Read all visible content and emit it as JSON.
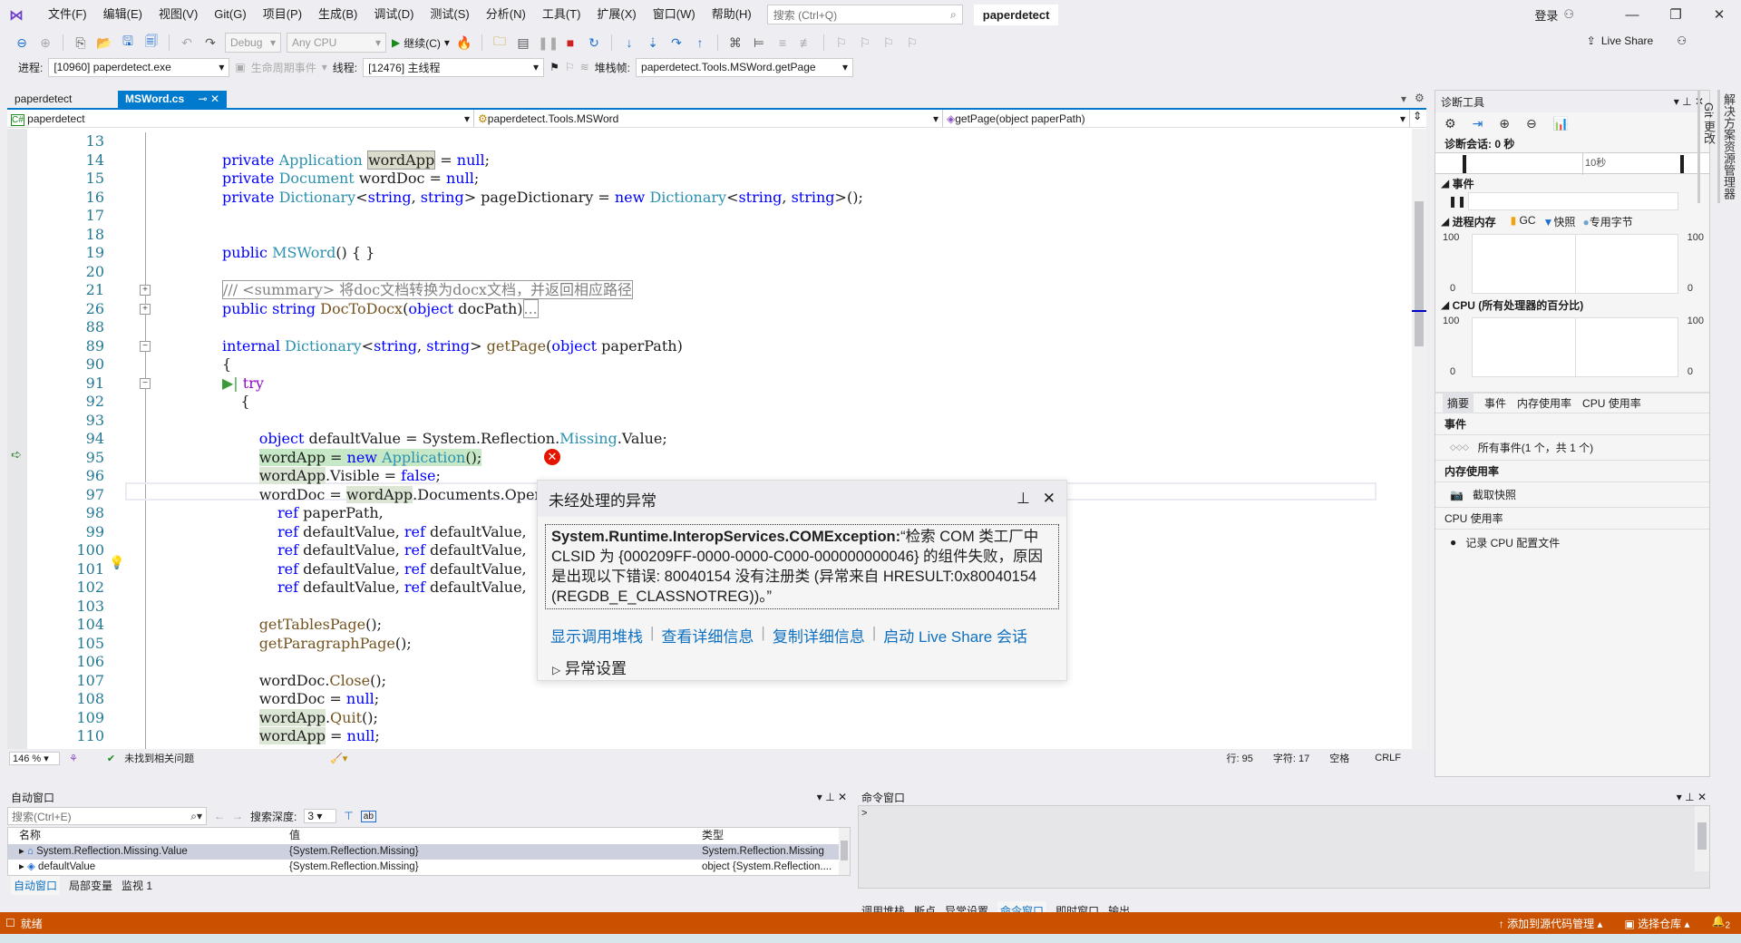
{
  "menubar": {
    "items": [
      "文件(F)",
      "编辑(E)",
      "视图(V)",
      "Git(G)",
      "项目(P)",
      "生成(B)",
      "调试(D)",
      "测试(S)",
      "分析(N)",
      "工具(T)",
      "扩展(X)",
      "窗口(W)",
      "帮助(H)"
    ],
    "search_placeholder": "搜索 (Ctrl+Q)",
    "solution_name": "paperdetect",
    "login": "登录"
  },
  "toolbar": {
    "config": "Debug",
    "platform": "Any CPU",
    "continue": "继续(C)",
    "live_share": "Live Share"
  },
  "debugbar": {
    "process_label": "进程:",
    "process": "[10960] paperdetect.exe",
    "lifecycle": "生命周期事件",
    "thread_label": "线程:",
    "thread": "[12476] 主线程",
    "stackframe_label": "堆栈帧:",
    "stackframe": "paperdetect.Tools.MSWord.getPage"
  },
  "tabs": [
    {
      "label": "paperdetect",
      "active": false
    },
    {
      "label": "MSWord.cs",
      "active": true
    }
  ],
  "navbar": {
    "project": "paperdetect",
    "type": "paperdetect.Tools.MSWord",
    "member": "getPage(object paperPath)"
  },
  "code_lines": [
    {
      "n": "13",
      "html": ""
    },
    {
      "n": "14",
      "html": "<span class='kw'>private</span> <span class='ty'>Application</span> <span style='background:#dcdccc;border:1px solid #999'>wordApp</span> = <span class='kw'>null</span>;"
    },
    {
      "n": "15",
      "html": "<span class='kw'>private</span> <span class='ty'>Document</span> wordDoc = <span class='kw'>null</span>;"
    },
    {
      "n": "16",
      "html": "<span class='kw'>private</span> <span class='ty'>Dictionary</span>&lt;<span class='kw'>string</span>, <span class='kw'>string</span>&gt; pageDictionary = <span class='kw'>new</span> <span class='ty'>Dictionary</span>&lt;<span class='kw'>string</span>, <span class='kw'>string</span>&gt;();"
    },
    {
      "n": "17",
      "html": ""
    },
    {
      "n": "18",
      "html": ""
    },
    {
      "n": "19",
      "html": "<span class='kw'>public</span> <span class='ty'>MSWord</span>() { }"
    },
    {
      "n": "20",
      "html": ""
    },
    {
      "n": "21",
      "html": "<span class='cm' style='border:1px solid #999'>/// &lt;summary&gt; 将doc文档转换为docx文档，并返回相应路径</span>"
    },
    {
      "n": "26",
      "html": "<span class='kw'>public</span> <span class='kw'>string</span> <span class='fn'>DocToDocx</span>(<span class='kw'>object</span> docPath)<span style='border:1px solid #999;color:#888'>...</span>"
    },
    {
      "n": "88",
      "html": ""
    },
    {
      "n": "89",
      "html": "<span class='kw'>internal</span> <span class='ty'>Dictionary</span>&lt;<span class='kw'>string</span>, <span class='kw'>string</span>&gt; <span class='fn'>getPage</span>(<span class='kw'>object</span> paperPath)"
    },
    {
      "n": "90",
      "html": "{"
    },
    {
      "n": "91",
      "html": "<span style='color:#3a9a3a'>▶|</span> <span class='ctl'>try</span>"
    },
    {
      "n": "92",
      "html": "    {"
    },
    {
      "n": "93",
      "html": ""
    },
    {
      "n": "94",
      "html": "        <span class='kw'>object</span> defaultValue = System.Reflection.<span class='ty'>Missing</span>.Value;"
    },
    {
      "n": "95",
      "html": "        <span style='background:#c6e8c6'>wordApp = <span class='kw'>new</span> <span class='ty'>Application</span>();</span>"
    },
    {
      "n": "96",
      "html": "        <span class='hl'>wordApp</span>.Visible = <span class='kw'>false</span>;"
    },
    {
      "n": "97",
      "html": "        wordDoc = <span class='hl'>wordApp</span>.Documents.Open("
    },
    {
      "n": "98",
      "html": "            <span class='kw'>ref</span> paperPath,"
    },
    {
      "n": "99",
      "html": "            <span class='kw'>ref</span> defaultValue, <span class='kw'>ref</span> defaultValue,"
    },
    {
      "n": "100",
      "html": "            <span class='kw'>ref</span> defaultValue, <span class='kw'>ref</span> defaultValue,"
    },
    {
      "n": "101",
      "html": "            <span class='kw'>ref</span> defaultValue, <span class='kw'>ref</span> defaultValue,"
    },
    {
      "n": "102",
      "html": "            <span class='kw'>ref</span> defaultValue, <span class='kw'>ref</span> defaultValue,"
    },
    {
      "n": "103",
      "html": ""
    },
    {
      "n": "104",
      "html": "        <span class='fn'>getTablesPage</span>();"
    },
    {
      "n": "105",
      "html": "        <span class='fn'>getParagraphPage</span>();"
    },
    {
      "n": "106",
      "html": ""
    },
    {
      "n": "107",
      "html": "        wordDoc.<span class='fn'>Close</span>();"
    },
    {
      "n": "108",
      "html": "        wordDoc = <span class='kw'>null</span>;"
    },
    {
      "n": "109",
      "html": "        <span class='hl'>wordApp</span>.<span class='fn'>Quit</span>();"
    },
    {
      "n": "110",
      "html": "        <span class='hl'>wordApp</span> = <span class='kw'>null</span>;"
    },
    {
      "n": "111",
      "html": ""
    }
  ],
  "editor_status": {
    "zoom": "146 %",
    "issues": "未找到相关问题",
    "line": "行: 95",
    "char": "字符: 17",
    "indent": "空格",
    "eol": "CRLF"
  },
  "exception": {
    "title": "未经处理的异常",
    "type": "System.Runtime.InteropServices.COMException:",
    "message": "“检索 COM 类工厂中 CLSID 为 {000209FF-0000-0000-C000-000000000046} 的组件失败，原因是出现以下错误: 80040154 没有注册类 (异常来自 HRESULT:0x80040154 (REGDB_E_CLASSNOTREG))。”",
    "links": [
      "显示调用堆栈",
      "查看详细信息",
      "复制详细信息",
      "启动 Live Share 会话"
    ],
    "settings": "异常设置"
  },
  "diagnostics": {
    "title": "诊断工具",
    "session": "诊断会话: 0 秒",
    "timeline_label": "10秒",
    "events_header": "事件",
    "memory_header": "进程内存",
    "legend": [
      "GC",
      "快照",
      "专用字节"
    ],
    "legend_colors": [
      "#f0a30a",
      "#1f6fd0",
      "#6ea6d0"
    ],
    "cpu_header": "CPU (所有处理器的百分比)",
    "y_max": "100",
    "y_min": "0",
    "tabs": [
      "摘要",
      "事件",
      "内存使用率",
      "CPU 使用率"
    ],
    "sec_events": "事件",
    "all_events": "所有事件(1 个，共 1 个)",
    "sec_memory": "内存使用率",
    "snapshot": "截取快照",
    "sec_cpu": "CPU 使用率",
    "record_cpu": "记录 CPU 配置文件"
  },
  "side_tabs": [
    "解决方案资源管理器",
    "Git 更改"
  ],
  "autos": {
    "title": "自动窗口",
    "search_placeholder": "搜索(Ctrl+E)",
    "depth_label": "搜索深度:",
    "depth": "3",
    "columns": [
      "名称",
      "值",
      "类型"
    ],
    "rows": [
      {
        "name": "System.Reflection.Missing.Value",
        "value": "{System.Reflection.Missing}",
        "type": "System.Reflection.Missing"
      },
      {
        "name": "defaultValue",
        "value": "{System.Reflection.Missing}",
        "type": "object {System.Reflection...."
      }
    ],
    "tabs": [
      "自动窗口",
      "局部变量",
      "监视 1"
    ]
  },
  "cmd": {
    "title": "命令窗口",
    "prompt": ">",
    "tabs": [
      "调用堆栈",
      "断点",
      "异常设置",
      "命令窗口",
      "即时窗口",
      "输出"
    ]
  },
  "statusbar": {
    "ready": "就绪",
    "add_source": "添加到源代码管理",
    "repo": "选择仓库",
    "notifications": "2",
    "color": "#ca5100"
  }
}
